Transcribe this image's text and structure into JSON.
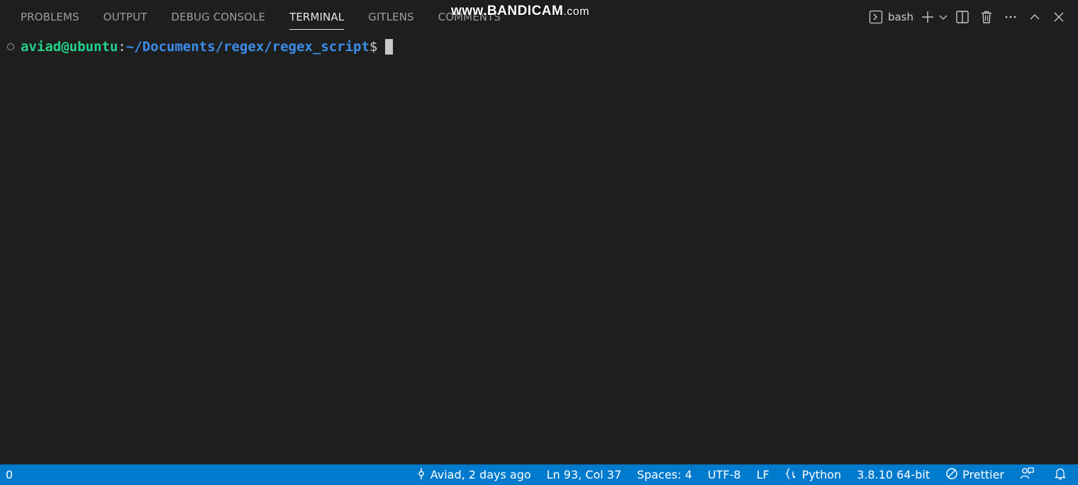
{
  "panel": {
    "tabs": [
      {
        "label": "PROBLEMS"
      },
      {
        "label": "OUTPUT"
      },
      {
        "label": "DEBUG CONSOLE"
      },
      {
        "label": "TERMINAL",
        "active": true
      },
      {
        "label": "GITLENS"
      },
      {
        "label": "COMMENTS"
      }
    ],
    "watermark": {
      "brand": "www.BANDICAM",
      "suffix": ".com"
    },
    "actions": {
      "shell_label": "bash",
      "icons": [
        "terminal-icon",
        "plus-icon",
        "chevron-down-icon",
        "split-icon",
        "trash-icon",
        "more-icon",
        "chevron-up-icon",
        "close-icon"
      ]
    }
  },
  "terminal": {
    "user_host": "aviad@ubuntu",
    "colon": ":",
    "path": "~/Documents/regex/regex_script",
    "prompt_char": "$",
    "colors": {
      "user": "#23d18b",
      "path": "#3b8eea",
      "background": "#1e1e1e"
    }
  },
  "statusbar": {
    "left": {
      "problems_count": "0"
    },
    "right": {
      "git_blame": "Aviad, 2 days ago",
      "cursor_position": "Ln 93, Col 37",
      "indentation": "Spaces: 4",
      "encoding": "UTF-8",
      "eol": "LF",
      "language": "Python",
      "interpreter": "3.8.10 64-bit",
      "formatter": "Prettier"
    },
    "color": "#007acc"
  }
}
